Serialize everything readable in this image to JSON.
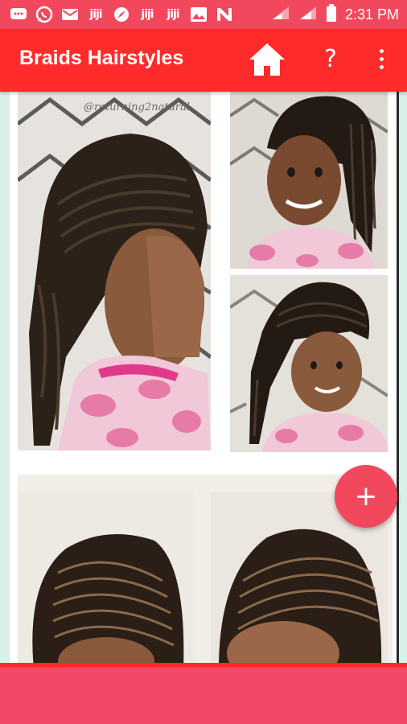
{
  "status_bar": {
    "time": "2:31 PM",
    "jiji_label": "jiji",
    "icons": [
      "message-icon",
      "whatsapp-icon",
      "mail-icon",
      "jiji-icon",
      "compass-icon",
      "jiji-icon",
      "jiji-icon",
      "image-icon",
      "n-app-icon",
      "signal-icon",
      "signal-icon",
      "battery-icon"
    ]
  },
  "app_bar": {
    "title": "Braids Hairstyles",
    "help_label": "?",
    "icons": [
      "home-icon",
      "help-icon",
      "more-vert-icon"
    ]
  },
  "gallery": {
    "cards": [
      {
        "images": [
          "braids-side-view",
          "girl-twists-smiling",
          "girl-cornrows-smiling"
        ],
        "watermark": "@returning2natural"
      },
      {
        "images": [
          "cornrows-back-left",
          "cornrows-back-right"
        ]
      }
    ]
  },
  "fab": {
    "label": "+"
  },
  "colors": {
    "status_bar": "#f2485e",
    "app_bar": "#ff2b2b",
    "fab": "#f2485e",
    "banner": "#f2486a",
    "background": "#d9efea"
  }
}
